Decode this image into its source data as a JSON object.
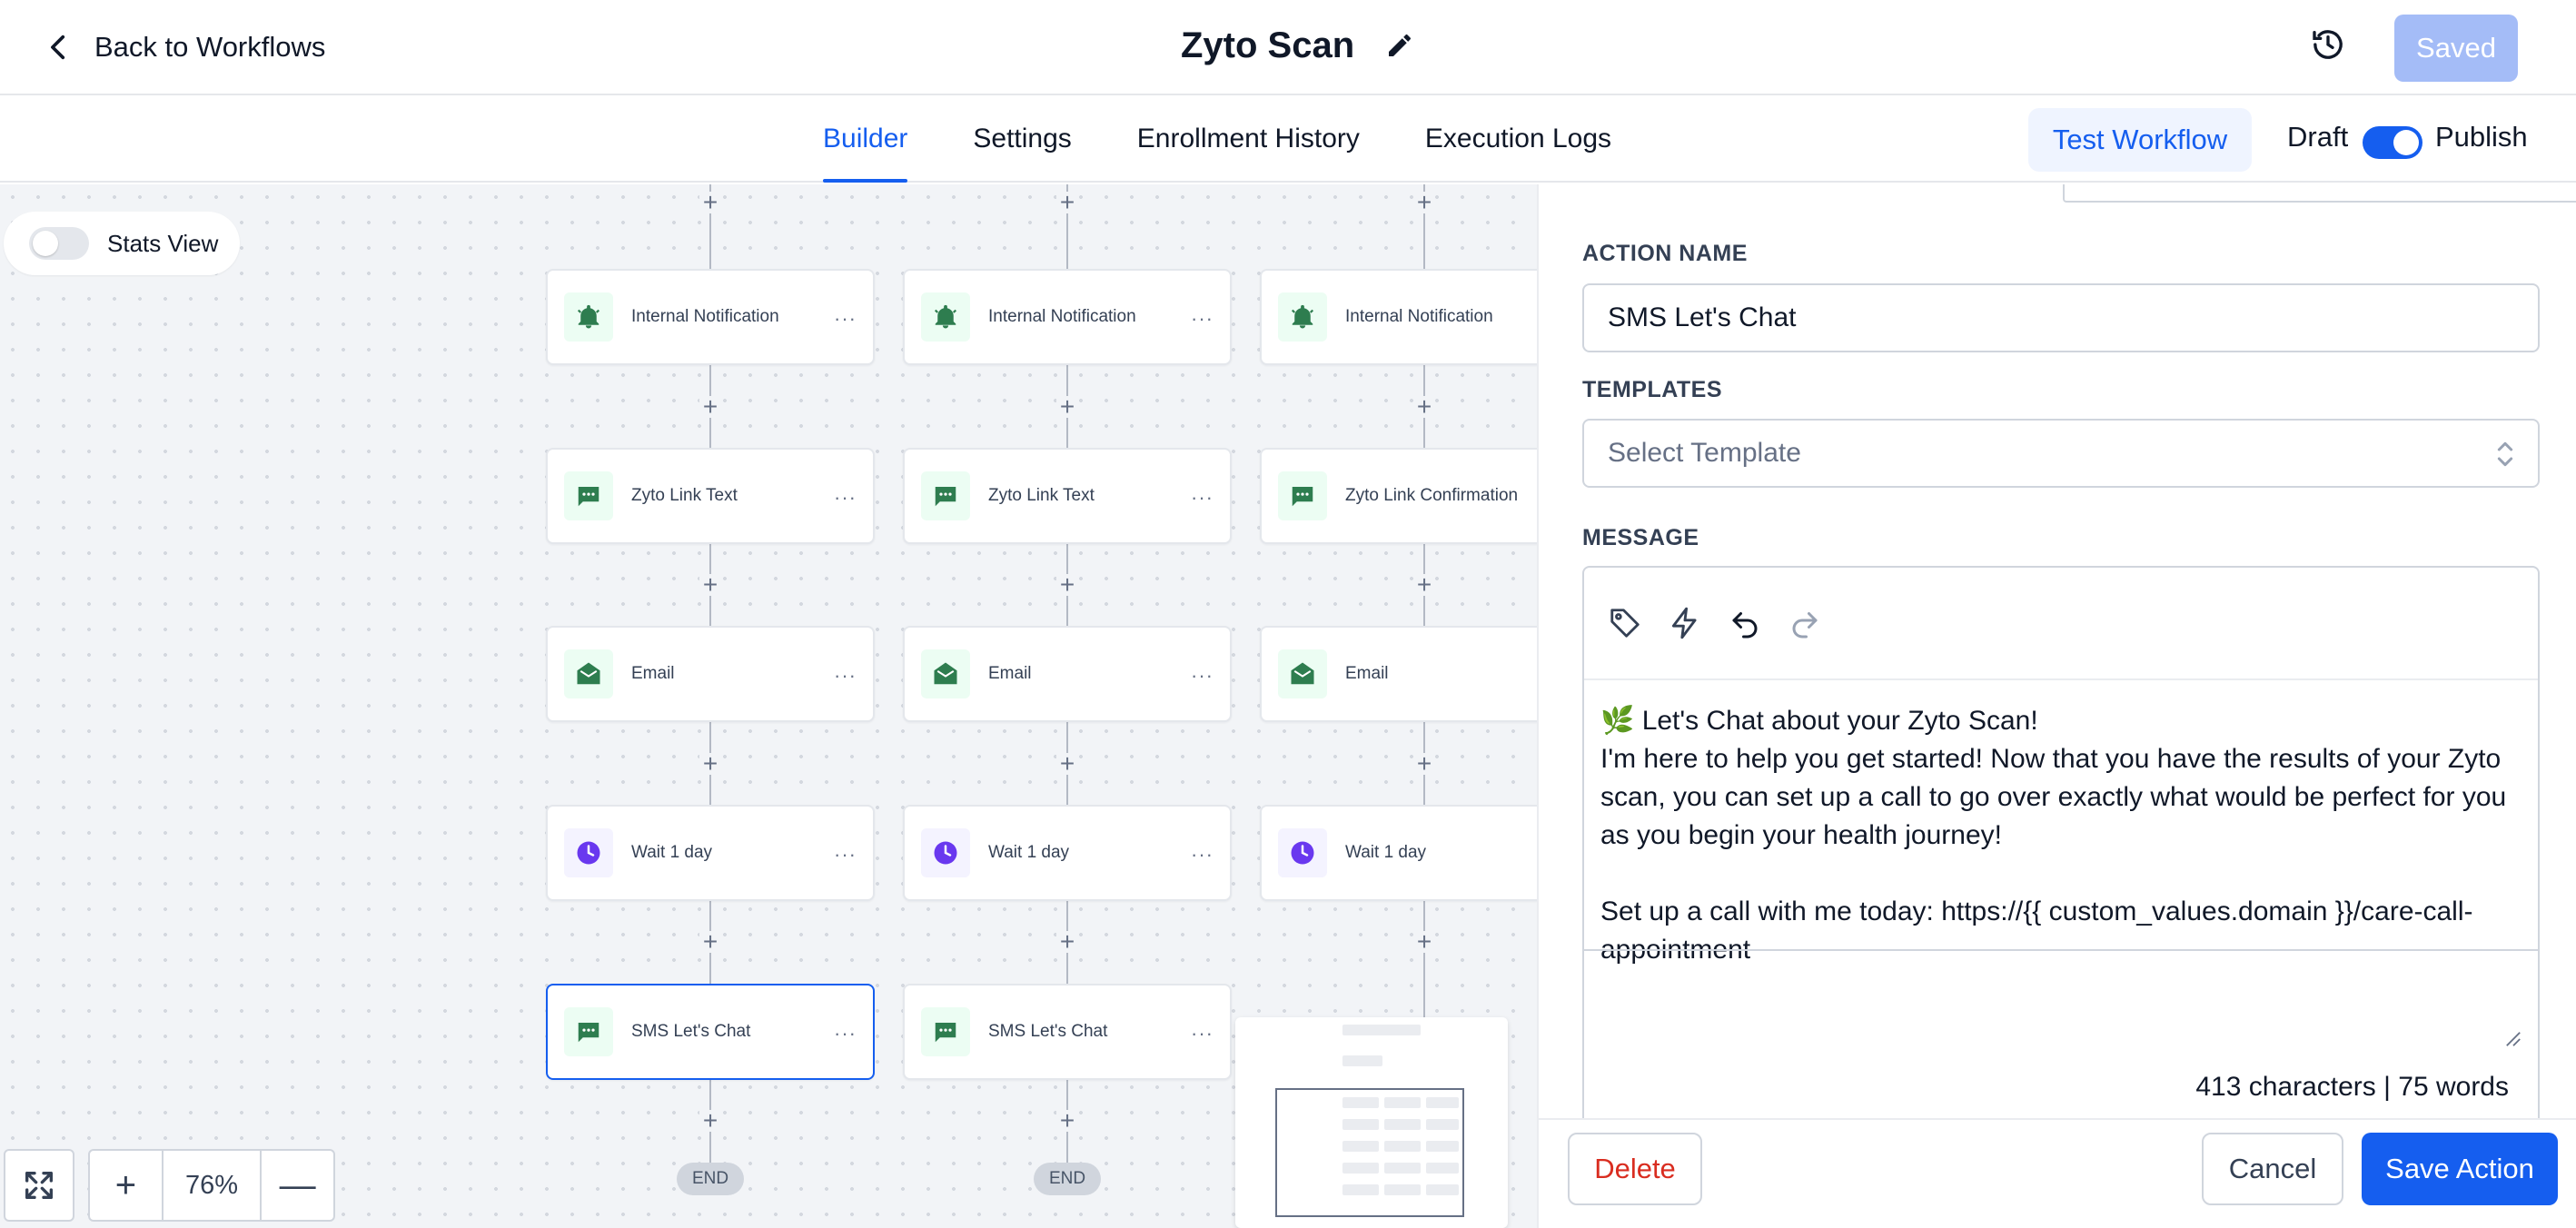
{
  "header": {
    "back_label": "Back to Workflows",
    "title": "Zyto Scan",
    "saved_label": "Saved"
  },
  "tabs": [
    {
      "label": "Builder",
      "active": true
    },
    {
      "label": "Settings",
      "active": false
    },
    {
      "label": "Enrollment History",
      "active": false
    },
    {
      "label": "Execution Logs",
      "active": false
    }
  ],
  "toolbar": {
    "test_label": "Test Workflow",
    "draft_label": "Draft",
    "publish_label": "Publish",
    "publish_on": true
  },
  "canvas": {
    "stats_label": "Stats View",
    "stats_on": false,
    "zoom": "76%",
    "columns": [
      {
        "nodes": [
          {
            "label": "Internal Notification",
            "icon": "bell-icon",
            "color": "green"
          },
          {
            "label": "Zyto Link Text",
            "icon": "message-icon",
            "color": "green"
          },
          {
            "label": "Email",
            "icon": "mail-icon",
            "color": "green"
          },
          {
            "label": "Wait 1 day",
            "icon": "clock-icon",
            "color": "purple"
          },
          {
            "label": "SMS Let's Chat",
            "icon": "message-icon",
            "color": "green",
            "selected": true
          }
        ],
        "end_label": "END"
      },
      {
        "nodes": [
          {
            "label": "Internal Notification",
            "icon": "bell-icon",
            "color": "green"
          },
          {
            "label": "Zyto Link Text",
            "icon": "message-icon",
            "color": "green"
          },
          {
            "label": "Email",
            "icon": "mail-icon",
            "color": "green"
          },
          {
            "label": "Wait 1 day",
            "icon": "clock-icon",
            "color": "purple"
          },
          {
            "label": "SMS Let's Chat",
            "icon": "message-icon",
            "color": "green"
          }
        ],
        "end_label": "END"
      },
      {
        "nodes": [
          {
            "label": "Internal Notification",
            "icon": "bell-icon",
            "color": "green"
          },
          {
            "label": "Zyto Link Confirmation",
            "icon": "message-icon",
            "color": "green"
          },
          {
            "label": "Email",
            "icon": "mail-icon",
            "color": "green"
          },
          {
            "label": "Wait 1 day",
            "icon": "clock-icon",
            "color": "purple"
          }
        ],
        "end_label": ""
      }
    ]
  },
  "panel": {
    "action_name_label": "ACTION NAME",
    "action_name_value": "SMS Let's Chat",
    "templates_label": "TEMPLATES",
    "templates_placeholder": "Select Template",
    "message_label": "MESSAGE",
    "message_text": "🌿 Let's Chat about your Zyto Scan!\nI'm here to help you get started! Now that you have the results of your Zyto scan, you can set up a call to go over exactly what would be perfect for you as you begin your health journey!\n\nSet up a call with me today: https://{{ custom_values.domain }}/care-call-appointment",
    "count_text": "413 characters | 75 words",
    "delete_label": "Delete",
    "cancel_label": "Cancel",
    "save_label": "Save Action"
  },
  "colors": {
    "accent": "#155eef",
    "node_green": "#2e7d4f",
    "node_purple": "#6938ef",
    "danger": "#d92d20"
  }
}
